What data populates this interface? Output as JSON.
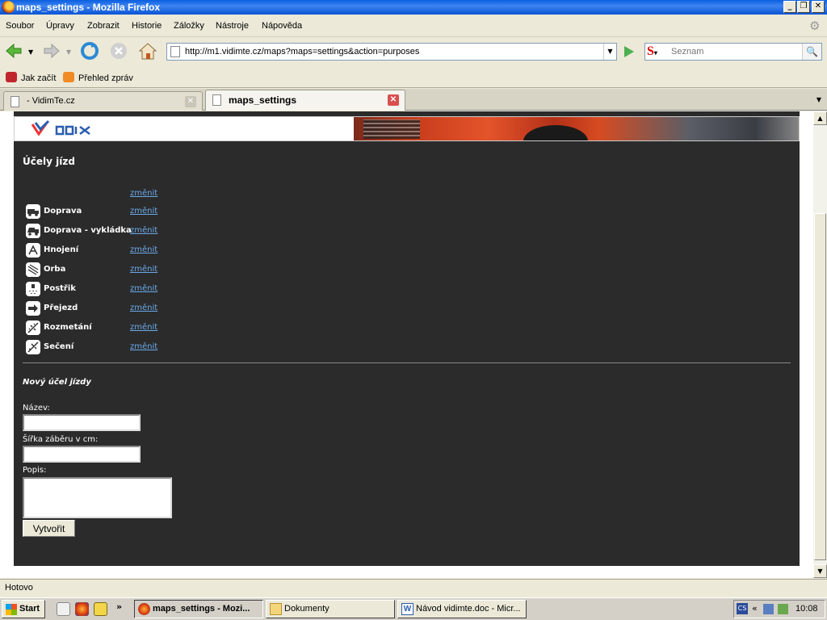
{
  "window": {
    "title": "maps_settings - Mozilla Firefox"
  },
  "menu": [
    "Soubor",
    "Úpravy",
    "Zobrazit",
    "Historie",
    "Záložky",
    "Nástroje",
    "Nápověda"
  ],
  "nav": {
    "url": "http://m1.vidimte.cz/maps?maps=settings&action=purposes",
    "search_placeholder": "Seznam"
  },
  "bookmarks": [
    "Jak začít",
    "Přehled zpráv"
  ],
  "tabs": [
    {
      "label": "- VidimTe.cz",
      "active": false
    },
    {
      "label": "maps_settings",
      "active": true
    }
  ],
  "page": {
    "title": "Účely jízd",
    "change_label": "změnit",
    "purposes": [
      "",
      "Doprava",
      "Doprava - vykládka",
      "Hnojení",
      "Orba",
      "Postřik",
      "Přejezd",
      "Rozmetání",
      "Sečení"
    ],
    "new_title": "Nový účel jízdy",
    "label_name": "Název:",
    "label_width": "Šířka záběru v cm:",
    "label_desc": "Popis:",
    "create_button": "Vytvořit"
  },
  "status": {
    "text": "Hotovo"
  },
  "taskbar": {
    "start": "Start",
    "buttons": [
      "maps_settings - Mozi...",
      "Dokumenty",
      "Návod vidimte.doc - Micr..."
    ],
    "clock": "10:08"
  }
}
